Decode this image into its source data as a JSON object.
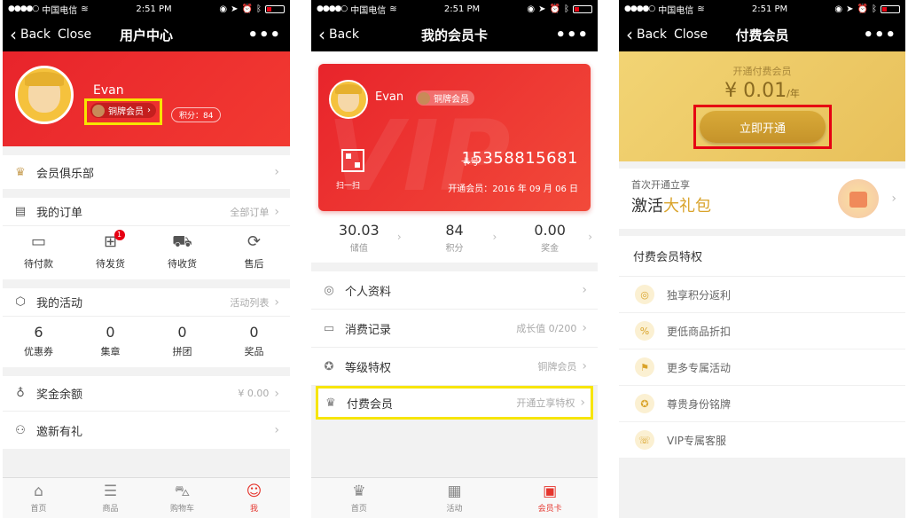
{
  "status": {
    "carrier": "中国电信",
    "time": "2:51 PM"
  },
  "p1": {
    "nav": {
      "back": "Back",
      "close": "Close",
      "title": "用户中心",
      "more": "•••"
    },
    "user": {
      "name": "Evan",
      "badge": "铜牌会员",
      "points": "积分：84"
    },
    "club": {
      "label": "会员俱乐部"
    },
    "orders": {
      "title": "我的订单",
      "all": "全部订单",
      "items": [
        {
          "label": "待付款",
          "icon": "wallet-icon"
        },
        {
          "label": "待发货",
          "icon": "box-icon",
          "badge": "1"
        },
        {
          "label": "待收货",
          "icon": "truck-icon"
        },
        {
          "label": "售后",
          "icon": "refund-icon"
        }
      ]
    },
    "activity": {
      "title": "我的活动",
      "list": "活动列表",
      "items": [
        {
          "num": "6",
          "label": "优惠券"
        },
        {
          "num": "0",
          "label": "集章"
        },
        {
          "num": "0",
          "label": "拼团"
        },
        {
          "num": "0",
          "label": "奖品"
        }
      ]
    },
    "balance": {
      "label": "奖金余额",
      "value": "¥ 0.00"
    },
    "invite": {
      "label": "邀新有礼"
    },
    "tabs": [
      {
        "label": "首页",
        "icon": "home-icon"
      },
      {
        "label": "商品",
        "icon": "list-icon"
      },
      {
        "label": "购物车",
        "icon": "cart-icon"
      },
      {
        "label": "我",
        "icon": "user-icon"
      }
    ]
  },
  "p2": {
    "nav": {
      "back": "Back",
      "title": "我的会员卡",
      "more": "•••"
    },
    "card": {
      "name": "Evan",
      "badge": "铜牌会员",
      "watermark": "VIP",
      "scan": "扫一扫",
      "cardno_label": "卡号",
      "cardno": "15358815681",
      "opened": "开通会员：2016 年 09 月 06 日"
    },
    "stats": [
      {
        "num": "30.03",
        "label": "储值"
      },
      {
        "num": "84",
        "label": "积分"
      },
      {
        "num": "0.00",
        "label": "奖金"
      }
    ],
    "rows": [
      {
        "label": "个人资料",
        "right": ""
      },
      {
        "label": "消费记录",
        "right": "成长值 0/200"
      },
      {
        "label": "等级特权",
        "right": "铜牌会员"
      },
      {
        "label": "付费会员",
        "right": "开通立享特权"
      }
    ],
    "tabs": [
      {
        "label": "首页",
        "icon": "crown-icon"
      },
      {
        "label": "活动",
        "icon": "calendar-icon"
      },
      {
        "label": "会员卡",
        "icon": "vip-card-icon"
      }
    ]
  },
  "p3": {
    "nav": {
      "back": "Back",
      "close": "Close",
      "title": "付费会员",
      "more": "•••"
    },
    "sub": "开通付费会员",
    "price": "¥ 0.01",
    "per": "/年",
    "open_btn": "立即开通",
    "gift": {
      "sub": "首次开通立享",
      "main_a": "激活",
      "main_b": "大礼包"
    },
    "priv_title": "付费会员特权",
    "privs": [
      "独享积分返利",
      "更低商品折扣",
      "更多专属活动",
      "尊贵身份铭牌",
      "VIP专属客服"
    ]
  }
}
